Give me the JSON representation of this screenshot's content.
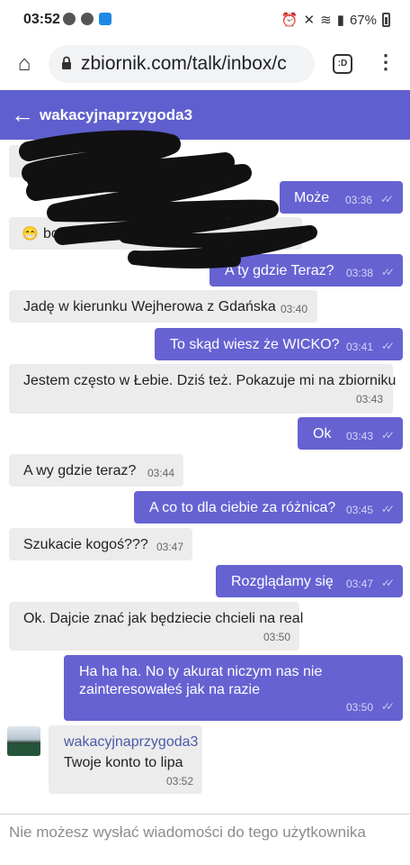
{
  "status_bar": {
    "time": "03:52",
    "battery": "67%"
  },
  "browser": {
    "url": "zbiornik.com/talk/inbox/c",
    "tab_count": ":D"
  },
  "header": {
    "title": "wakacyjnaprzygoda3"
  },
  "messages": [
    {
      "dir": "in",
      "text": "",
      "time": ""
    },
    {
      "dir": "out",
      "text": "Może",
      "time": "03:36"
    },
    {
      "dir": "in",
      "text": "bo jest cie napisane że",
      "time": "03:38"
    },
    {
      "dir": "out",
      "text": "A ty gdzie Teraz?",
      "time": "03:38"
    },
    {
      "dir": "in",
      "text": "Jadę w kierunku Wejherowa z Gdańska",
      "time": "03:40"
    },
    {
      "dir": "out",
      "text": "To skąd wiesz że WICKO?",
      "time": "03:41"
    },
    {
      "dir": "in",
      "text": "Jestem często w Łebie. Dziś też. Pokazuje mi na zbiorniku",
      "time": "03:43"
    },
    {
      "dir": "out",
      "text": "Ok",
      "time": "03:43"
    },
    {
      "dir": "in",
      "text": "A wy gdzie teraz?",
      "time": "03:44"
    },
    {
      "dir": "out",
      "text": "A co to dla ciebie za różnica?",
      "time": "03:45"
    },
    {
      "dir": "in",
      "text": "Szukacie kogoś???",
      "time": "03:47"
    },
    {
      "dir": "out",
      "text": "Rozglądamy się",
      "time": "03:47"
    },
    {
      "dir": "in",
      "text": "Ok. Dajcie znać jak będziecie chcieli na real",
      "time": "03:50"
    },
    {
      "dir": "out",
      "text": "Ha ha ha. No ty akurat niczym nas nie zainteresowałeś jak na razie",
      "line1": "Ha ha ha. No ty akurat niczym nas nie",
      "line2": "zainteresowałeś jak na razie",
      "time": "03:50"
    },
    {
      "dir": "in",
      "sender": "wakacyjnaprzygoda3",
      "text": "Twoje konto to lipa",
      "time": "03:52"
    }
  ],
  "footer": {
    "notice": "Nie możesz wysłać wiadomości do tego użytkownika"
  },
  "colors": {
    "header": "#5f5fcf",
    "outgoing": "#6662d2",
    "incoming": "#ececec"
  }
}
